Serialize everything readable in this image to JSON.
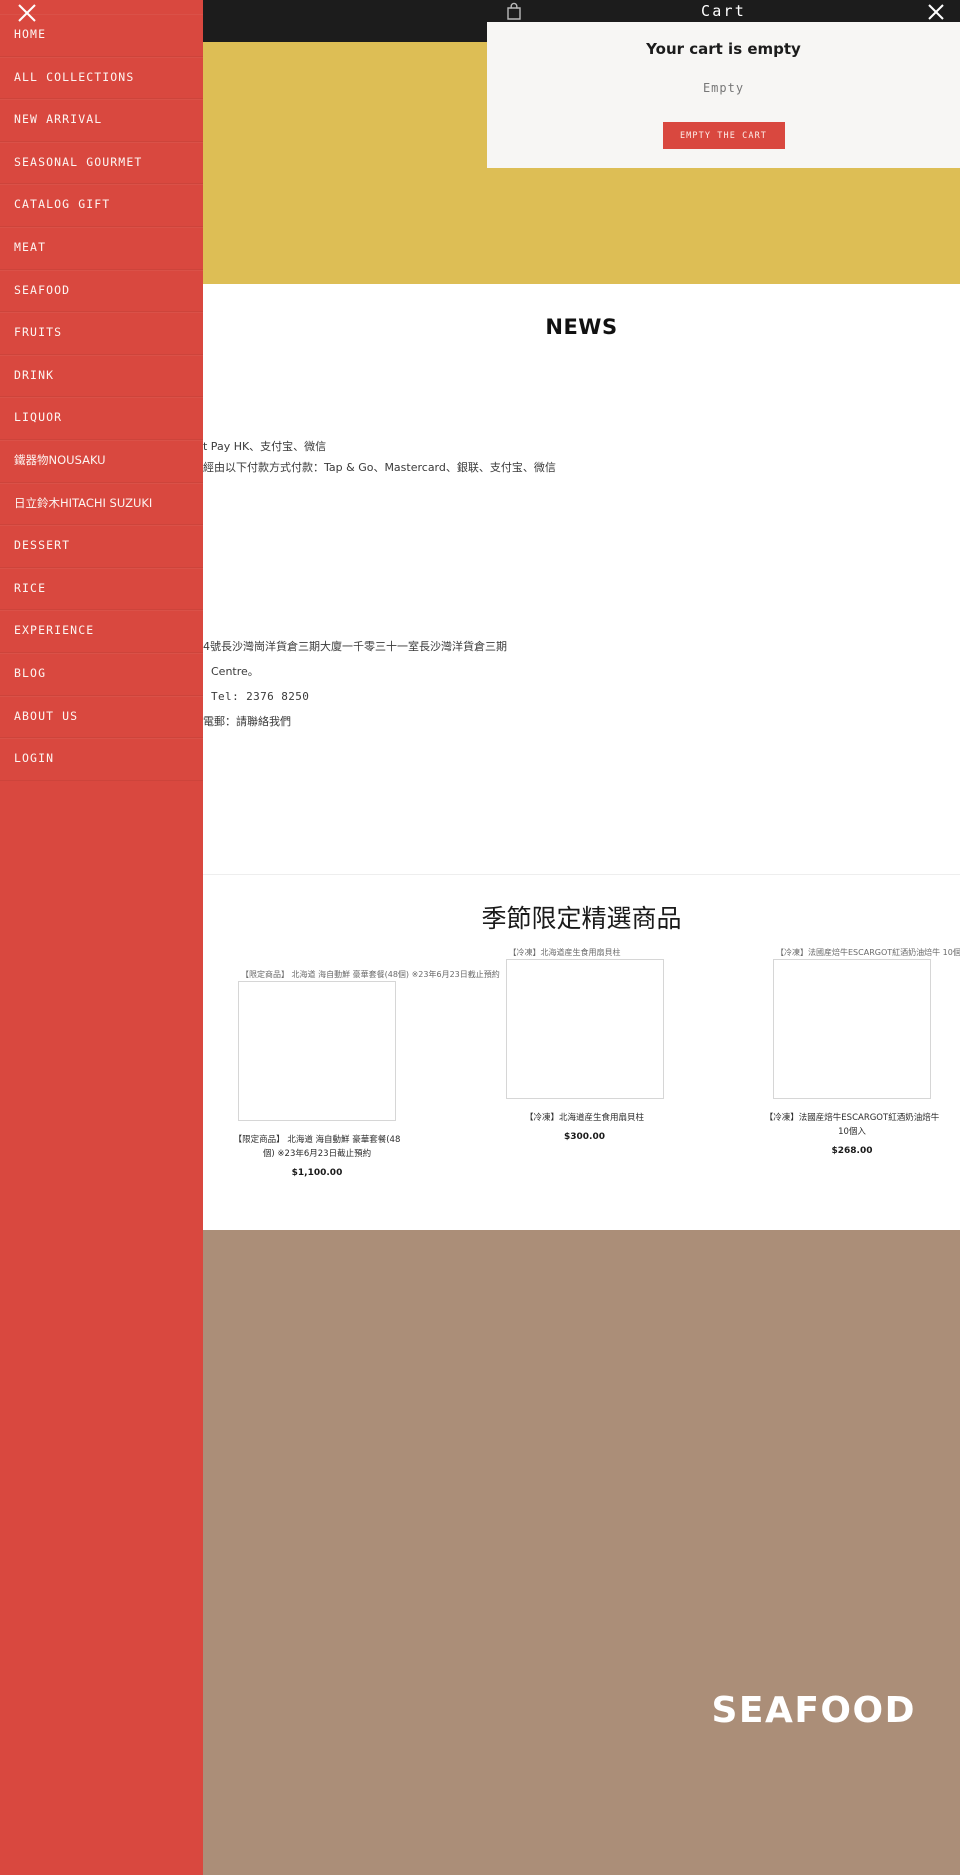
{
  "sidebar": {
    "close_icon": "close-icon",
    "items": [
      {
        "label": "HOME"
      },
      {
        "label": "ALL COLLECTIONS"
      },
      {
        "label": "NEW ARRIVAL"
      },
      {
        "label": "SEASONAL GOURMET"
      },
      {
        "label": "CATALOG GIFT"
      },
      {
        "label": "MEAT"
      },
      {
        "label": "SEAFOOD"
      },
      {
        "label": "FRUITS"
      },
      {
        "label": "DRINK"
      },
      {
        "label": "LIQUOR"
      },
      {
        "label": "鐵器物NOUSAKU"
      },
      {
        "label": "日立鈴木HITACHI SUZUKI"
      },
      {
        "label": "DESSERT"
      },
      {
        "label": "RICE"
      },
      {
        "label": "EXPERIENCE"
      },
      {
        "label": "BLOG"
      },
      {
        "label": "ABOUT US"
      },
      {
        "label": "LOGIN"
      }
    ]
  },
  "cart": {
    "bag_icon": "shopping-bag-icon",
    "title": "Cart",
    "close_icon": "close-icon",
    "empty_title": "Your cart is empty",
    "empty_subtext": "Empty",
    "empty_button_label": "EMPTY THE CART"
  },
  "news": {
    "heading": "NEWS",
    "lines": [
      "t Pay HK、支付宝、微信",
      "經由以下付款方式付款：Tap & Go、Mastercard、銀联、支付宝、微信"
    ],
    "contact_lines": [
      "4號長沙灣崗洋貨倉三期大廈一千零三十一室長沙灣洋貨倉三期",
      "Centre。",
      "Tel: 2376 8250",
      "電郵：請聯絡我們"
    ]
  },
  "products": {
    "heading": "季節限定精選商品",
    "items": [
      {
        "alt": "【限定商品】 北海道 海自動鮮 豪華套餐(48個) ※23年6月23日截止預約",
        "title": "【限定商品】 北海道 海自動鮮 豪華套餐(48個) ※23年6月23日截止預約",
        "price": "$1,100.00"
      },
      {
        "alt": "【冷凍】北海道産生食用扇貝柱",
        "title": "【冷凍】北海道産生食用扇貝柱",
        "price": "$300.00"
      },
      {
        "alt": "【冷凍】法國産焙牛ESCARGOT紅酒奶油焙牛 10個入",
        "title": "【冷凍】法國産焙牛ESCARGOT紅酒奶油焙牛 10個入",
        "price": "$268.00"
      }
    ]
  },
  "seafood_banner": {
    "label": "SEAFOOD"
  },
  "colors": {
    "sidebar_red": "#d9483f",
    "hero_gold": "#ddbe55",
    "dark_bar": "#1c1c1c",
    "banner_tan": "#ab8e78",
    "cart_panel_bg": "#f7f6f4"
  }
}
